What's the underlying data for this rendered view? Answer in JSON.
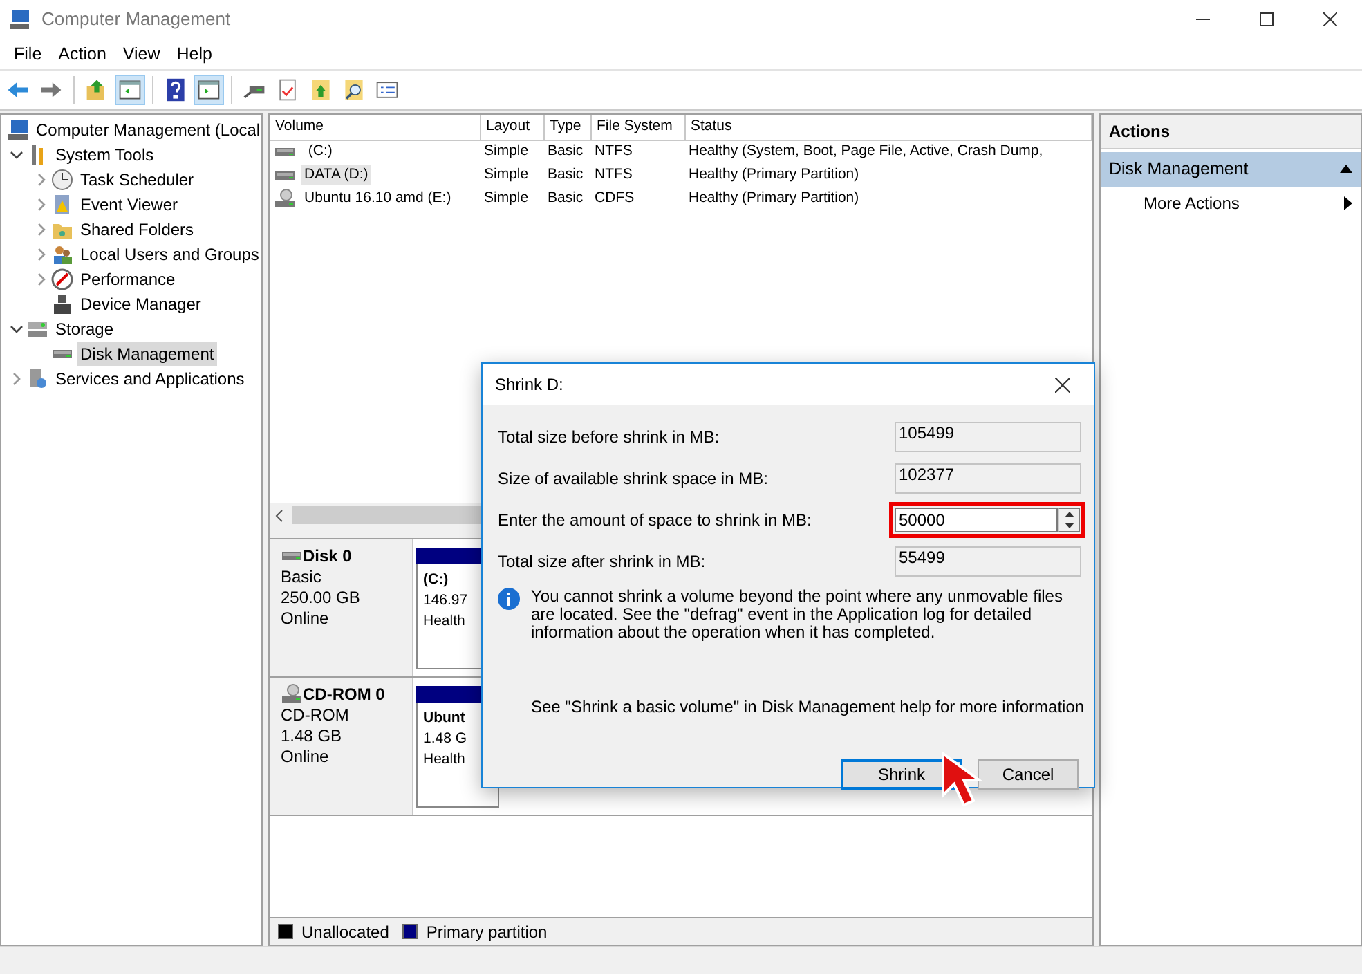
{
  "window": {
    "title": "Computer Management"
  },
  "menu": [
    "File",
    "Action",
    "View",
    "Help"
  ],
  "toolbar": [
    {
      "kind": "back",
      "pressed": false
    },
    {
      "kind": "forward",
      "pressed": false
    },
    {
      "kind": "up",
      "pressed": false
    },
    {
      "kind": "tree",
      "pressed": true
    },
    {
      "kind": "help",
      "pressed": false
    },
    {
      "kind": "pane",
      "pressed": true
    },
    {
      "kind": "connect",
      "pressed": false
    },
    {
      "kind": "check",
      "pressed": false
    },
    {
      "kind": "export",
      "pressed": false
    },
    {
      "kind": "find",
      "pressed": false
    },
    {
      "kind": "list",
      "pressed": false
    }
  ],
  "tree": [
    {
      "label": "Computer Management (Local",
      "kind": "computer",
      "selected": false,
      "children": [
        {
          "label": "System Tools",
          "kind": "tools",
          "expanded": true,
          "selected": false,
          "children": [
            {
              "label": "Task Scheduler",
              "kind": "clock",
              "expanded": false,
              "selected": false
            },
            {
              "label": "Event Viewer",
              "kind": "log",
              "expanded": false,
              "selected": false
            },
            {
              "label": "Shared Folders",
              "kind": "folder",
              "expanded": false,
              "selected": false
            },
            {
              "label": "Local Users and Groups",
              "kind": "users",
              "expanded": false,
              "selected": false
            },
            {
              "label": "Performance",
              "kind": "gauge",
              "expanded": false,
              "selected": false
            },
            {
              "label": "Device Manager",
              "kind": "device",
              "selected": false
            }
          ]
        },
        {
          "label": "Storage",
          "kind": "storage",
          "expanded": true,
          "selected": false,
          "children": [
            {
              "label": "Disk Management",
              "kind": "drive",
              "selected": true
            }
          ]
        },
        {
          "label": "Services and Applications",
          "kind": "services",
          "expanded": false,
          "selected": false
        }
      ]
    }
  ],
  "volumes": {
    "columns": [
      "Volume",
      "Layout",
      "Type",
      "File System",
      "Status"
    ],
    "rows": [
      {
        "kind": "drive",
        "selected": false,
        "cells": [
          " (C:)",
          "Simple",
          "Basic",
          "NTFS",
          "Healthy (System, Boot, Page File, Active, Crash Dump,"
        ]
      },
      {
        "kind": "drive",
        "selected": true,
        "cells": [
          "DATA (D:)",
          "Simple",
          "Basic",
          "NTFS",
          "Healthy (Primary Partition)"
        ]
      },
      {
        "kind": "cd",
        "selected": false,
        "cells": [
          "Ubuntu 16.10 amd (E:)",
          "Simple",
          "Basic",
          "CDFS",
          "Healthy (Primary Partition)"
        ]
      }
    ]
  },
  "disks": [
    {
      "kind": "drive",
      "name": "Disk 0",
      "type": "Basic",
      "size": "250.00 GB",
      "status": "Online",
      "partitions": [
        {
          "label": "(C:)",
          "size": "146.97",
          "status": "Health",
          "color": "#000080"
        }
      ]
    },
    {
      "kind": "cd",
      "name": "CD-ROM 0",
      "type": "CD-ROM",
      "size": "1.48 GB",
      "status": "Online",
      "partitions": [
        {
          "label": "Ubunt",
          "size": "1.48 G",
          "status": "Health",
          "color": "#000080"
        }
      ]
    }
  ],
  "legend": [
    {
      "label": "Unallocated",
      "color": "#000000"
    },
    {
      "label": "Primary partition",
      "color": "#000080"
    }
  ],
  "actions": {
    "header": "Actions",
    "section": {
      "label": "Disk Management",
      "expanded": true
    },
    "items": [
      {
        "label": "More Actions"
      }
    ]
  },
  "dialog": {
    "title": "Shrink D:",
    "fields": [
      {
        "kind": "readonly",
        "label": "Total size before shrink in MB:",
        "value": "105499"
      },
      {
        "kind": "readonly",
        "label": "Size of available shrink space in MB:",
        "value": "102377"
      },
      {
        "kind": "spin",
        "label": "Enter the amount of space to shrink in MB:",
        "value": "50000",
        "highlighted": true
      },
      {
        "kind": "readonly",
        "label": "Total size after shrink in MB:",
        "value": "55499"
      }
    ],
    "info": "You cannot shrink a volume beyond the point where any unmovable files are located. See the \"defrag\" event in the Application log for detailed information about the operation when it has completed.",
    "help": "See \"Shrink a basic volume\" in Disk Management help for more information",
    "buttons": [
      {
        "label": "Shrink",
        "focused": true
      },
      {
        "label": "Cancel",
        "focused": false
      }
    ]
  }
}
